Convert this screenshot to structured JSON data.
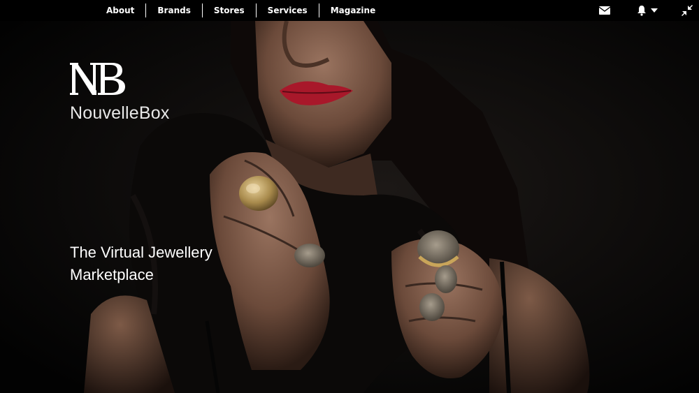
{
  "nav": {
    "items": [
      {
        "label": "About"
      },
      {
        "label": "Brands"
      },
      {
        "label": "Stores"
      },
      {
        "label": "Services"
      },
      {
        "label": "Magazine"
      }
    ],
    "icons": [
      "envelope-icon",
      "bell-icon",
      "chevron-down-icon",
      "arrows-collapse-icon"
    ]
  },
  "hero": {
    "logo_mark": "NB",
    "brand_name": "NouvelleBox",
    "tagline": "The Virtual Jewellery Marketplace"
  },
  "colors": {
    "background": "#000000",
    "lipstick": "#b0182a",
    "gold": "#c9a55a",
    "text": "#ffffff"
  }
}
